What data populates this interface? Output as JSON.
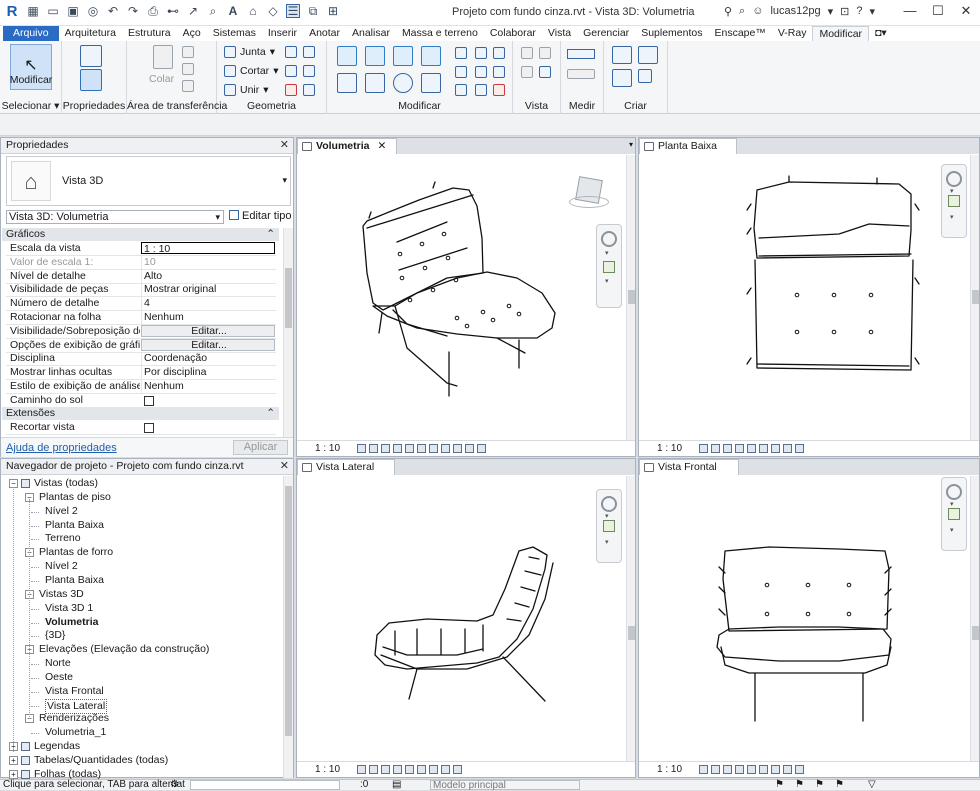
{
  "titlebar": {
    "title": "Projeto com fundo cinza.rvt - Vista 3D: Volumetria",
    "user": "lucas12pg"
  },
  "ribbon_tabs": [
    "Arquivo",
    "Arquitetura",
    "Estrutura",
    "Aço",
    "Sistemas",
    "Inserir",
    "Anotar",
    "Analisar",
    "Massa e terreno",
    "Colaborar",
    "Vista",
    "Gerenciar",
    "Suplementos",
    "Enscape™",
    "V-Ray",
    "Modificar"
  ],
  "ribbon": {
    "modificar_btn": "Modificar",
    "colar": "Colar",
    "junta": "Junta",
    "cortar": "Cortar",
    "unir": "Unir",
    "panels": [
      "Selecionar",
      "Propriedades",
      "Área de transferência",
      "Geometria",
      "Modificar",
      "Vista",
      "Medir",
      "Criar"
    ]
  },
  "properties": {
    "header": "Propriedades",
    "type_name": "Vista 3D",
    "selector": "Vista 3D: Volumetria",
    "edit_type": "Editar tipo",
    "section_graphics": "Gráficos",
    "rows": [
      {
        "k": "Escala da vista",
        "v": "1 : 10"
      },
      {
        "k": "Valor de escala    1:",
        "v": "10"
      },
      {
        "k": "Nível de detalhe",
        "v": "Alto"
      },
      {
        "k": "Visibilidade de peças",
        "v": "Mostrar original"
      },
      {
        "k": "Número de detalhe",
        "v": "4"
      },
      {
        "k": "Rotacionar na folha",
        "v": "Nenhum"
      },
      {
        "k": "Visibilidade/Sobreposição de ...",
        "v": "Editar..."
      },
      {
        "k": "Opções de exibição de gráficos",
        "v": "Editar..."
      },
      {
        "k": "Disciplina",
        "v": "Coordenação"
      },
      {
        "k": "Mostrar linhas ocultas",
        "v": "Por disciplina"
      },
      {
        "k": "Estilo de exibição de análise p...",
        "v": "Nenhum"
      },
      {
        "k": "Caminho do sol",
        "v": ""
      }
    ],
    "section_ext": "Extensões",
    "crop_label": "Recortar vista",
    "help_link": "Ajuda de propriedades",
    "apply": "Aplicar"
  },
  "browser": {
    "header": "Navegador de projeto - Projeto com fundo cinza.rvt",
    "items": [
      {
        "t": "Vistas (todas)",
        "d": 0
      },
      {
        "t": "Plantas de piso",
        "d": 1
      },
      {
        "t": "Nível 2",
        "d": 2
      },
      {
        "t": "Planta Baixa",
        "d": 2
      },
      {
        "t": "Terreno",
        "d": 2
      },
      {
        "t": "Plantas de forro",
        "d": 1
      },
      {
        "t": "Nível 2",
        "d": 2
      },
      {
        "t": "Planta Baixa",
        "d": 2
      },
      {
        "t": "Vistas 3D",
        "d": 1
      },
      {
        "t": "Vista 3D 1",
        "d": 2
      },
      {
        "t": "Volumetria",
        "d": 2
      },
      {
        "t": "{3D}",
        "d": 2
      },
      {
        "t": "Elevações (Elevação da construção)",
        "d": 1
      },
      {
        "t": "Norte",
        "d": 2
      },
      {
        "t": "Oeste",
        "d": 2
      },
      {
        "t": "Vista Frontal",
        "d": 2
      },
      {
        "t": "Vista Lateral",
        "d": 2
      },
      {
        "t": "Renderizações",
        "d": 1
      },
      {
        "t": "Volumetria_1",
        "d": 2
      },
      {
        "t": "Legendas",
        "d": 0
      },
      {
        "t": "Tabelas/Quantidades (todas)",
        "d": 0
      },
      {
        "t": "Folhas (todas)",
        "d": 0
      }
    ]
  },
  "views": {
    "v1": "Volumetria",
    "v2": "Planta Baixa",
    "v3": "Vista Lateral",
    "v4": "Vista Frontal",
    "scale": "1 : 10"
  },
  "status": {
    "hint": "Clique para selecionar, TAB para alternat",
    "count": ":0",
    "model": "Modelo principal"
  }
}
